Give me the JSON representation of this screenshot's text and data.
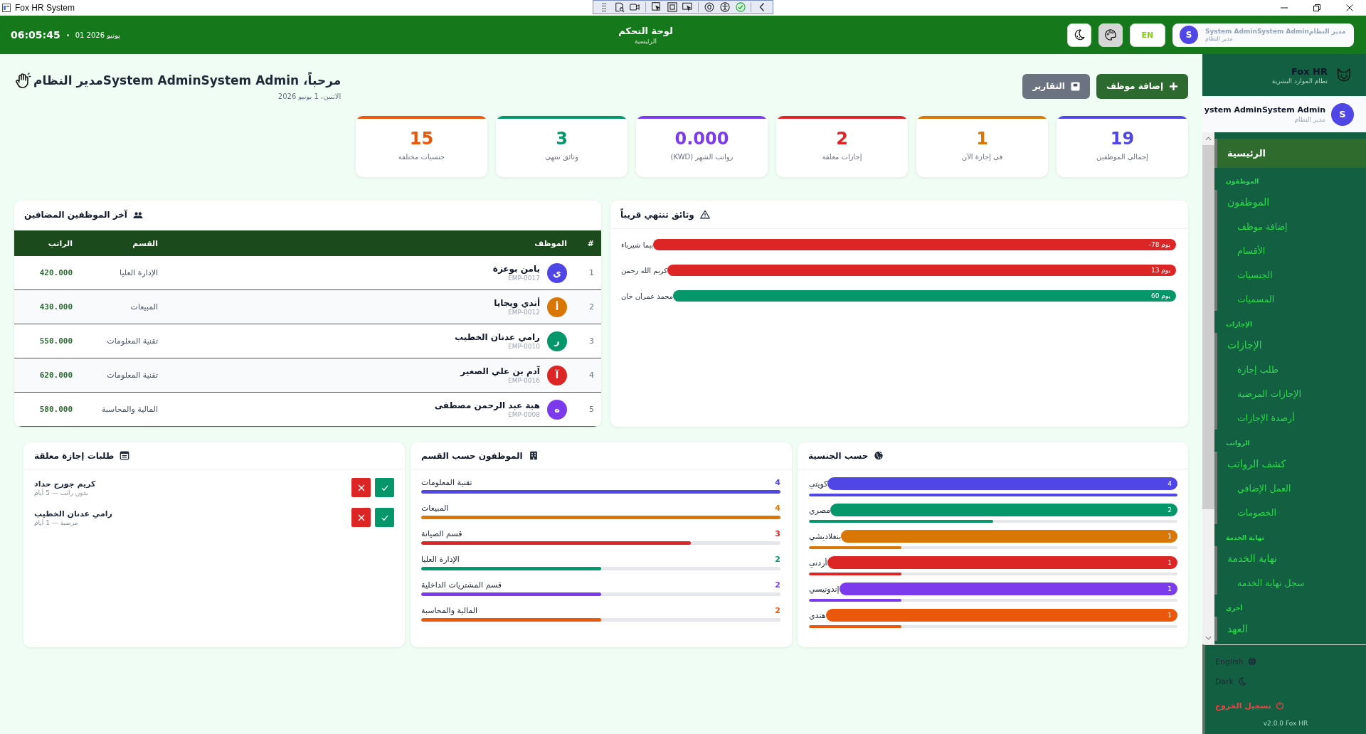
{
  "window": {
    "title": "Fox HR System"
  },
  "header": {
    "time": "06:05:45",
    "date": "01 يونيو 2026",
    "title": "لوحة التحكم",
    "subtitle": "الرئيسية",
    "language_button": "EN",
    "user": {
      "initial": "S",
      "name": "System AdminSystem Adminمدير النظام",
      "role": "مدير النظام"
    }
  },
  "page_header": {
    "greeting": "مرحباً، System AdminSystem Adminمدير النظام",
    "date": "الاثنين، 1 يونيو 2026",
    "actions": [
      {
        "kind": "primary",
        "label": "إضافة موظف"
      },
      {
        "kind": "secondary",
        "label": "التقارير"
      }
    ]
  },
  "stats": [
    {
      "value": "19",
      "label": "إجمالي الموظفين",
      "color": "#4f46e5"
    },
    {
      "value": "1",
      "label": "في إجازة الآن",
      "color": "#d97706"
    },
    {
      "value": "2",
      "label": "إجازات معلقة",
      "color": "#dc2626"
    },
    {
      "value": "0.000",
      "label": "رواتب الشهر (KWD)",
      "color": "#7c3aed"
    },
    {
      "value": "3",
      "label": "وثائق تنتهي",
      "color": "#059669"
    },
    {
      "value": "15",
      "label": "جنسيات مختلفة",
      "color": "#ea580c"
    }
  ],
  "recent_employees": {
    "title": "آخر الموظفين المضافين",
    "columns": [
      "#",
      "الموظف",
      "القسم",
      "الراتب"
    ],
    "rows": [
      {
        "index": "1",
        "initial": "ي",
        "color": "#4f46e5",
        "name": "يامن بوعزة",
        "code": "EMP-0017",
        "department": "الإدارة العليا",
        "salary": "420.000"
      },
      {
        "index": "2",
        "initial": "أ",
        "color": "#d97706",
        "name": "أندي ويجايا",
        "code": "EMP-0012",
        "department": "المبيعات",
        "salary": "430.000"
      },
      {
        "index": "3",
        "initial": "ر",
        "color": "#059669",
        "name": "رامي عدنان الخطيب",
        "code": "EMP-0010",
        "department": "تقنية المعلومات",
        "salary": "550.000"
      },
      {
        "index": "4",
        "initial": "آ",
        "color": "#dc2626",
        "name": "آدم بن علي الصغير",
        "code": "EMP-0016",
        "department": "تقنية المعلومات",
        "salary": "620.000"
      },
      {
        "index": "5",
        "initial": "ه",
        "color": "#7c3aed",
        "name": "هبة عبد الرحمن مصطفى",
        "code": "EMP-0008",
        "department": "المالية والمحاسبة",
        "salary": "580.000"
      }
    ]
  },
  "expiring_documents": {
    "title": "وثائق تنتهي قريباً",
    "items": [
      {
        "name": "بيما شيرباء",
        "days": "-78 يوم",
        "color": "#dc2626"
      },
      {
        "name": "كريم الله رحمن",
        "days": "13 يوم",
        "color": "#dc2626"
      },
      {
        "name": "محمد عمران خان",
        "days": "60 يوم",
        "color": "#059669"
      }
    ]
  },
  "leave_requests": {
    "title": "طلبات إجازة معلقة",
    "items": [
      {
        "name": "كريم جورج حداد",
        "detail": "بدون راتب — 5 أيام"
      },
      {
        "name": "رامي عدنان الخطيب",
        "detail": "مرضية — 1 أيام"
      }
    ]
  },
  "departments": {
    "title": "الموظفون حسب القسم",
    "items": [
      {
        "label": "تقنية المعلومات",
        "count": "4",
        "level": 1,
        "color": "#4f46e5"
      },
      {
        "label": "المبيعات",
        "count": "4",
        "level": 1,
        "color": "#d97706"
      },
      {
        "label": "قسم الصيانة",
        "count": "3",
        "level": 0.75,
        "color": "#dc2626"
      },
      {
        "label": "الإدارة العليا",
        "count": "2",
        "level": 0.5,
        "color": "#059669"
      },
      {
        "label": "قسم المشتريات الداخلية",
        "count": "2",
        "level": 0.5,
        "color": "#7c3aed"
      },
      {
        "label": "المالية والمحاسبة",
        "count": "2",
        "level": 0.5,
        "color": "#ea580c"
      }
    ]
  },
  "nationalities": {
    "title": "حسب الجنسية",
    "items": [
      {
        "label": "كويتي",
        "count": "4",
        "level": 1,
        "color": "#4f46e5"
      },
      {
        "label": "مصري",
        "count": "2",
        "level": 0.5,
        "color": "#059669"
      },
      {
        "label": "بنغلاديشي",
        "count": "1",
        "level": 0.25,
        "color": "#d97706"
      },
      {
        "label": "أردني",
        "count": "1",
        "level": 0.25,
        "color": "#dc2626"
      },
      {
        "label": "إندونيسي",
        "count": "1",
        "level": 0.25,
        "color": "#7c3aed"
      },
      {
        "label": "هندي",
        "count": "1",
        "level": 0.25,
        "color": "#ea580c"
      }
    ]
  },
  "sidebar": {
    "brand": "Fox HR",
    "brand_subtitle": "نظام الموارد البشرية",
    "user": {
      "initial": "S",
      "name": "ystem AdminSystem Admin",
      "role": "مدير النظام"
    },
    "home": {
      "label": "الرئيسية",
      "selected": true
    },
    "sections": [
      {
        "title": "الموظفون",
        "items": [
          {
            "label": "الموظفون",
            "selected": false,
            "children": [
              {
                "label": "إضافة موظف",
                "selected": false
              },
              {
                "label": "الأقسام",
                "selected": false
              },
              {
                "label": "الجنسيات",
                "selected": false
              },
              {
                "label": "المسميات",
                "selected": false
              }
            ]
          }
        ]
      },
      {
        "title": "الإجازات",
        "items": [
          {
            "label": "الإجازات",
            "selected": false,
            "children": [
              {
                "label": "طلب إجازة",
                "selected": false
              },
              {
                "label": "الإجازات المرضية",
                "selected": false
              },
              {
                "label": "أرصدة الإجازات",
                "selected": false
              }
            ]
          }
        ]
      },
      {
        "title": "الرواتب",
        "items": [
          {
            "label": "كشف الرواتب",
            "selected": false,
            "children": [
              {
                "label": "العمل الإضافي",
                "selected": false
              },
              {
                "label": "الخصومات",
                "selected": false
              }
            ]
          }
        ]
      },
      {
        "title": "نهاية الخدمة",
        "items": [
          {
            "label": "نهاية الخدمة",
            "selected": false,
            "children": [
              {
                "label": "سجل نهاية الخدمة",
                "selected": false
              }
            ]
          }
        ]
      },
      {
        "title": "أخرى",
        "items": [
          {
            "label": "العهد",
            "selected": false
          }
        ]
      }
    ],
    "footer": [
      {
        "kind": "language",
        "label": "English"
      },
      {
        "kind": "theme",
        "label": "Dark"
      },
      {
        "kind": "logout",
        "label": "تسجيل الخروج"
      }
    ],
    "version": "v2.0.0 Fox HR"
  }
}
